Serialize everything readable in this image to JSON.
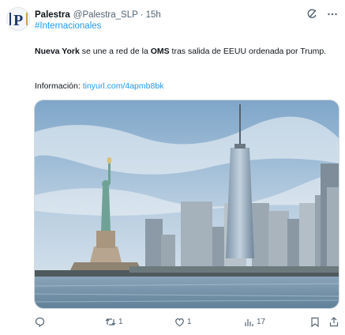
{
  "author": {
    "name": "Palestra",
    "handle": "@Palestra_SLP",
    "separator": "·",
    "time": "15h",
    "avatar_letter": "P"
  },
  "hashtag": "#Internacionales",
  "body": {
    "p1": "Nueva York",
    "p2": " se une a red de la ",
    "p3": "OMS",
    "p4": " tras salida de EEUU ordenada por Trump."
  },
  "info": {
    "label": "Información: ",
    "link": "tinyurl.com/4apmb8bk"
  },
  "icons": {
    "grok": "grok-icon",
    "more": "more-icon",
    "reply": "reply-icon",
    "retweet": "retweet-icon",
    "like": "heart-icon",
    "views": "views-icon",
    "bookmark": "bookmark-icon",
    "share": "share-icon"
  },
  "actions": {
    "reply_count": "",
    "retweet_count": "1",
    "like_count": "1",
    "views_count": "17"
  },
  "colors": {
    "link": "#1d9bf0",
    "muted": "#536471",
    "text": "#0f1419"
  }
}
